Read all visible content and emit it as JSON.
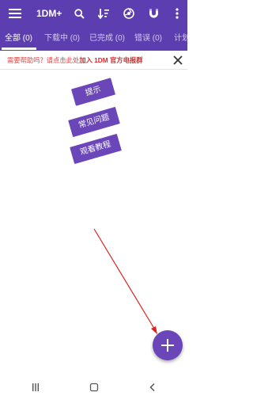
{
  "app": {
    "title": "1DM+",
    "icons": [
      "menu-icon",
      "search-icon",
      "sort-icon",
      "browser-globe-icon",
      "magnet-icon",
      "more-vert-icon"
    ]
  },
  "tabs": [
    {
      "label": "全部 (0)",
      "active": true
    },
    {
      "label": "下载中 (0)",
      "active": false
    },
    {
      "label": "已完成 (0)",
      "active": false
    },
    {
      "label": "错误 (0)",
      "active": false
    },
    {
      "label": "计划",
      "active": false
    }
  ],
  "banner": {
    "text": "需要帮助吗？请点击此处",
    "link": "加入 1DM 官方电报群",
    "close_icon": "close-icon"
  },
  "tips": [
    {
      "label": "提示"
    },
    {
      "label": "常见问题"
    },
    {
      "label": "观看教程"
    }
  ],
  "annotation": {
    "color": "#e02020"
  },
  "fab": {
    "icon": "plus-icon"
  },
  "navbar": {
    "icons": [
      "recent-apps-icon",
      "home-icon",
      "back-icon"
    ]
  },
  "colors": {
    "primary": "#5c3eb0",
    "accent": "#6a46b8",
    "banner_red": "#e04747"
  }
}
